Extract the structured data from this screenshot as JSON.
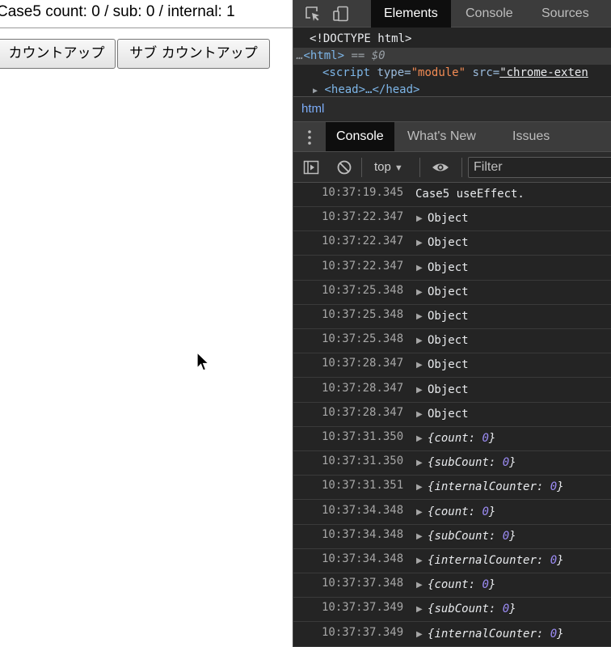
{
  "page": {
    "heading": "Case5 count: 0 / sub: 0 / internal: 1",
    "count_button": "カウントアップ",
    "sub_button": "サブ カウントアップ"
  },
  "devtools": {
    "tabs": [
      "Elements",
      "Console",
      "Sources"
    ],
    "active_tab": "Elements",
    "dom": {
      "doctype": "<!DOCTYPE html>",
      "html_open": "<html>",
      "selected_marker": "== $0",
      "script_tag": "<script",
      "script_attr1": "type=",
      "script_val1": "\"module\"",
      "script_attr2": "src=",
      "script_val2": "\"chrome-exten",
      "head_tag": "<head>…</head>"
    },
    "breadcrumb": "html",
    "drawer_tabs": [
      "Console",
      "What's New",
      "Issues"
    ],
    "console_toolbar": {
      "context": "top",
      "filter_placeholder": "Filter"
    },
    "log": [
      {
        "time": "10:37:19.345",
        "kind": "text",
        "text": "Case5 useEffect."
      },
      {
        "time": "10:37:22.347",
        "kind": "plain",
        "text": "Object"
      },
      {
        "time": "10:37:22.347",
        "kind": "plain",
        "text": "Object"
      },
      {
        "time": "10:37:22.347",
        "kind": "plain",
        "text": "Object"
      },
      {
        "time": "10:37:25.348",
        "kind": "plain",
        "text": "Object"
      },
      {
        "time": "10:37:25.348",
        "kind": "plain",
        "text": "Object"
      },
      {
        "time": "10:37:25.348",
        "kind": "plain",
        "text": "Object"
      },
      {
        "time": "10:37:28.347",
        "kind": "plain",
        "text": "Object"
      },
      {
        "time": "10:37:28.347",
        "kind": "plain",
        "text": "Object"
      },
      {
        "time": "10:37:28.347",
        "kind": "plain",
        "text": "Object"
      },
      {
        "time": "10:37:31.350",
        "kind": "kv",
        "key": "count",
        "value": "0"
      },
      {
        "time": "10:37:31.350",
        "kind": "kv",
        "key": "subCount",
        "value": "0"
      },
      {
        "time": "10:37:31.351",
        "kind": "kv",
        "key": "internalCounter",
        "value": "0"
      },
      {
        "time": "10:37:34.348",
        "kind": "kv",
        "key": "count",
        "value": "0"
      },
      {
        "time": "10:37:34.348",
        "kind": "kv",
        "key": "subCount",
        "value": "0"
      },
      {
        "time": "10:37:34.348",
        "kind": "kv",
        "key": "internalCounter",
        "value": "0"
      },
      {
        "time": "10:37:37.348",
        "kind": "kv",
        "key": "count",
        "value": "0"
      },
      {
        "time": "10:37:37.349",
        "kind": "kv",
        "key": "subCount",
        "value": "0"
      },
      {
        "time": "10:37:37.349",
        "kind": "kv",
        "key": "internalCounter",
        "value": "0"
      }
    ]
  }
}
